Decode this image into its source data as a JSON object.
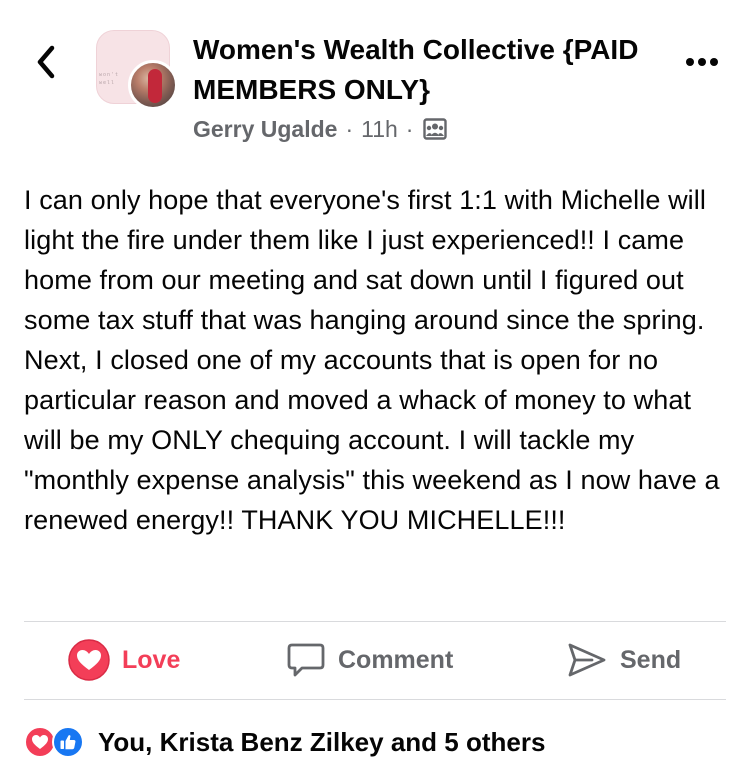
{
  "header": {
    "group_name": "Women's Wealth Collective {PAID MEMBERS ONLY}",
    "author": "Gerry Ugalde",
    "separator": "·",
    "time": "11h",
    "group_logo_text": "won't\nwell"
  },
  "post": {
    "body": "I can only hope that everyone's first 1:1 with Michelle will light the fire under them like I just experienced!! I came home from our meeting and sat down until I figured out some tax stuff that was hanging around since the spring. Next, I closed one of my accounts that is open for no particular reason and moved a whack of money to what will be my ONLY chequing account. I will tackle my \"monthly expense analysis\" this weekend as I now have a renewed energy!! THANK YOU MICHELLE!!!"
  },
  "actions": {
    "love_label": "Love",
    "comment_label": "Comment",
    "send_label": "Send"
  },
  "reactions": {
    "summary": "You, Krista Benz Zilkey and 5 others"
  },
  "icons": {
    "back": "chevron-left-icon",
    "more": "more-dots-icon",
    "audience": "group-audience-icon",
    "love": "heart-icon",
    "comment": "comment-bubble-icon",
    "send": "send-arrow-icon",
    "reaction_love": "heart-reaction-icon",
    "reaction_like": "thumbs-up-reaction-icon"
  },
  "colors": {
    "love_red": "#f33e58",
    "like_blue": "#1877f2",
    "secondary_text": "#65676b",
    "primary_text": "#050505"
  }
}
